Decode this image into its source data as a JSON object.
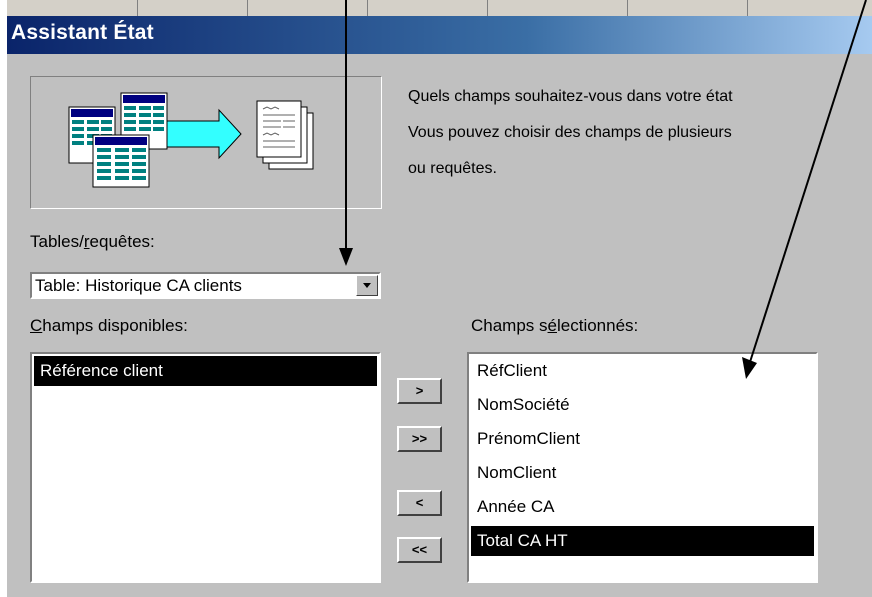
{
  "window": {
    "title": "Assistant État"
  },
  "intro": {
    "line1": "Quels champs souhaitez-vous dans votre état",
    "line2": "Vous pouvez choisir des champs de plusieurs",
    "line3": "ou requêtes."
  },
  "tables": {
    "label_pre": "Tables/",
    "label_key": "r",
    "label_post": "equêtes:",
    "selected": "Table: Historique CA clients"
  },
  "available": {
    "label_key": "C",
    "label_post": "hamps disponibles:",
    "items": [
      "Référence client"
    ],
    "selected_index": 0
  },
  "selected_fields": {
    "label_pre": "Champs s",
    "label_key": "é",
    "label_post": "lectionnés:",
    "items": [
      "RéfClient",
      "NomSociété",
      "PrénomClient",
      "NomClient",
      "Année CA",
      "Total CA HT"
    ],
    "selected_index": 5
  },
  "buttons": {
    "add_one": ">",
    "add_all": ">>",
    "remove_one": "<",
    "remove_all": "<<"
  },
  "colors": {
    "dialog_bg": "#c0c0c0",
    "selection": "#000000",
    "title_start": "#0a246a",
    "title_end": "#a6caf0",
    "arrow_graphic": "#33ffff"
  },
  "icons": {
    "illustration": "table-to-report-icon",
    "dropdown": "dropdown-arrow-icon"
  }
}
